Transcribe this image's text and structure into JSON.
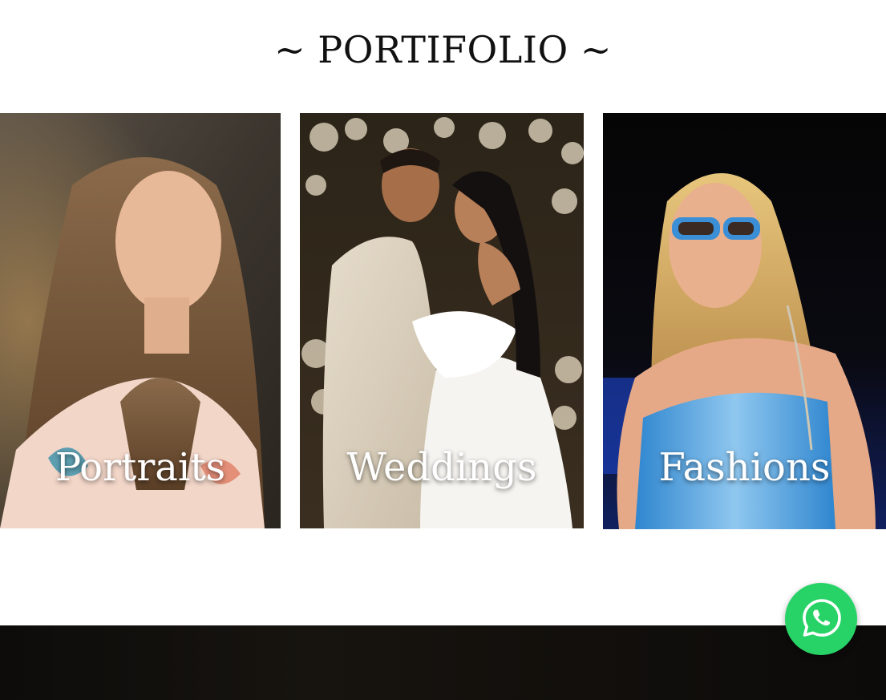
{
  "portfolio": {
    "title": "~ PORTIFOLIO ~",
    "cards": [
      {
        "label": "Portraits"
      },
      {
        "label": "Weddings"
      },
      {
        "label": "Fashions"
      }
    ]
  },
  "whatsapp": {
    "icon": "whatsapp-icon",
    "color": "#27d366"
  },
  "colors": {
    "background": "#ffffff",
    "title": "#111111",
    "label": "#ffffff",
    "footer": "#0f0d0b"
  }
}
